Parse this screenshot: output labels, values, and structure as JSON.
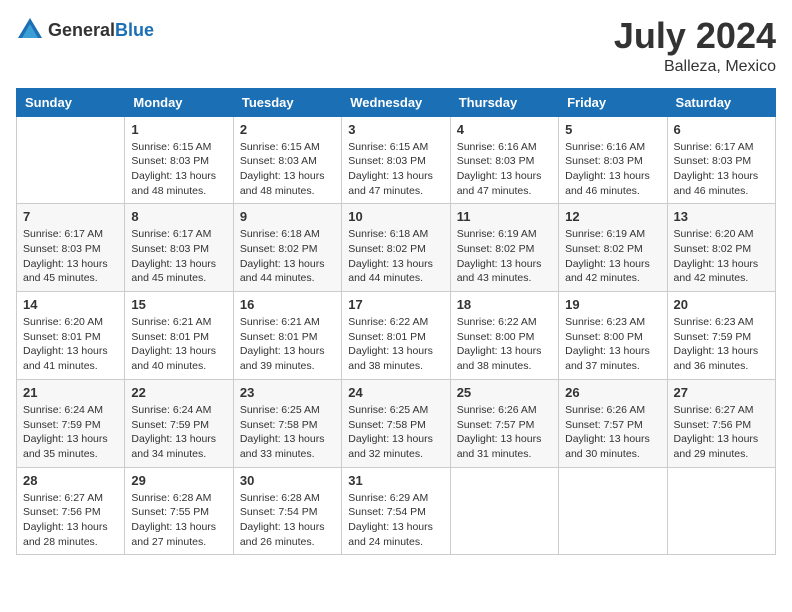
{
  "header": {
    "logo_general": "General",
    "logo_blue": "Blue",
    "month_year": "July 2024",
    "location": "Balleza, Mexico"
  },
  "days_of_week": [
    "Sunday",
    "Monday",
    "Tuesday",
    "Wednesday",
    "Thursday",
    "Friday",
    "Saturday"
  ],
  "weeks": [
    [
      {
        "day": "",
        "info": ""
      },
      {
        "day": "1",
        "info": "Sunrise: 6:15 AM\nSunset: 8:03 PM\nDaylight: 13 hours\nand 48 minutes."
      },
      {
        "day": "2",
        "info": "Sunrise: 6:15 AM\nSunset: 8:03 AM\nDaylight: 13 hours\nand 48 minutes."
      },
      {
        "day": "3",
        "info": "Sunrise: 6:15 AM\nSunset: 8:03 PM\nDaylight: 13 hours\nand 47 minutes."
      },
      {
        "day": "4",
        "info": "Sunrise: 6:16 AM\nSunset: 8:03 PM\nDaylight: 13 hours\nand 47 minutes."
      },
      {
        "day": "5",
        "info": "Sunrise: 6:16 AM\nSunset: 8:03 PM\nDaylight: 13 hours\nand 46 minutes."
      },
      {
        "day": "6",
        "info": "Sunrise: 6:17 AM\nSunset: 8:03 PM\nDaylight: 13 hours\nand 46 minutes."
      }
    ],
    [
      {
        "day": "7",
        "info": "Sunrise: 6:17 AM\nSunset: 8:03 PM\nDaylight: 13 hours\nand 45 minutes."
      },
      {
        "day": "8",
        "info": "Sunrise: 6:17 AM\nSunset: 8:03 PM\nDaylight: 13 hours\nand 45 minutes."
      },
      {
        "day": "9",
        "info": "Sunrise: 6:18 AM\nSunset: 8:02 PM\nDaylight: 13 hours\nand 44 minutes."
      },
      {
        "day": "10",
        "info": "Sunrise: 6:18 AM\nSunset: 8:02 PM\nDaylight: 13 hours\nand 44 minutes."
      },
      {
        "day": "11",
        "info": "Sunrise: 6:19 AM\nSunset: 8:02 PM\nDaylight: 13 hours\nand 43 minutes."
      },
      {
        "day": "12",
        "info": "Sunrise: 6:19 AM\nSunset: 8:02 PM\nDaylight: 13 hours\nand 42 minutes."
      },
      {
        "day": "13",
        "info": "Sunrise: 6:20 AM\nSunset: 8:02 PM\nDaylight: 13 hours\nand 42 minutes."
      }
    ],
    [
      {
        "day": "14",
        "info": "Sunrise: 6:20 AM\nSunset: 8:01 PM\nDaylight: 13 hours\nand 41 minutes."
      },
      {
        "day": "15",
        "info": "Sunrise: 6:21 AM\nSunset: 8:01 PM\nDaylight: 13 hours\nand 40 minutes."
      },
      {
        "day": "16",
        "info": "Sunrise: 6:21 AM\nSunset: 8:01 PM\nDaylight: 13 hours\nand 39 minutes."
      },
      {
        "day": "17",
        "info": "Sunrise: 6:22 AM\nSunset: 8:01 PM\nDaylight: 13 hours\nand 38 minutes."
      },
      {
        "day": "18",
        "info": "Sunrise: 6:22 AM\nSunset: 8:00 PM\nDaylight: 13 hours\nand 38 minutes."
      },
      {
        "day": "19",
        "info": "Sunrise: 6:23 AM\nSunset: 8:00 PM\nDaylight: 13 hours\nand 37 minutes."
      },
      {
        "day": "20",
        "info": "Sunrise: 6:23 AM\nSunset: 7:59 PM\nDaylight: 13 hours\nand 36 minutes."
      }
    ],
    [
      {
        "day": "21",
        "info": "Sunrise: 6:24 AM\nSunset: 7:59 PM\nDaylight: 13 hours\nand 35 minutes."
      },
      {
        "day": "22",
        "info": "Sunrise: 6:24 AM\nSunset: 7:59 PM\nDaylight: 13 hours\nand 34 minutes."
      },
      {
        "day": "23",
        "info": "Sunrise: 6:25 AM\nSunset: 7:58 PM\nDaylight: 13 hours\nand 33 minutes."
      },
      {
        "day": "24",
        "info": "Sunrise: 6:25 AM\nSunset: 7:58 PM\nDaylight: 13 hours\nand 32 minutes."
      },
      {
        "day": "25",
        "info": "Sunrise: 6:26 AM\nSunset: 7:57 PM\nDaylight: 13 hours\nand 31 minutes."
      },
      {
        "day": "26",
        "info": "Sunrise: 6:26 AM\nSunset: 7:57 PM\nDaylight: 13 hours\nand 30 minutes."
      },
      {
        "day": "27",
        "info": "Sunrise: 6:27 AM\nSunset: 7:56 PM\nDaylight: 13 hours\nand 29 minutes."
      }
    ],
    [
      {
        "day": "28",
        "info": "Sunrise: 6:27 AM\nSunset: 7:56 PM\nDaylight: 13 hours\nand 28 minutes."
      },
      {
        "day": "29",
        "info": "Sunrise: 6:28 AM\nSunset: 7:55 PM\nDaylight: 13 hours\nand 27 minutes."
      },
      {
        "day": "30",
        "info": "Sunrise: 6:28 AM\nSunset: 7:54 PM\nDaylight: 13 hours\nand 26 minutes."
      },
      {
        "day": "31",
        "info": "Sunrise: 6:29 AM\nSunset: 7:54 PM\nDaylight: 13 hours\nand 24 minutes."
      },
      {
        "day": "",
        "info": ""
      },
      {
        "day": "",
        "info": ""
      },
      {
        "day": "",
        "info": ""
      }
    ]
  ]
}
